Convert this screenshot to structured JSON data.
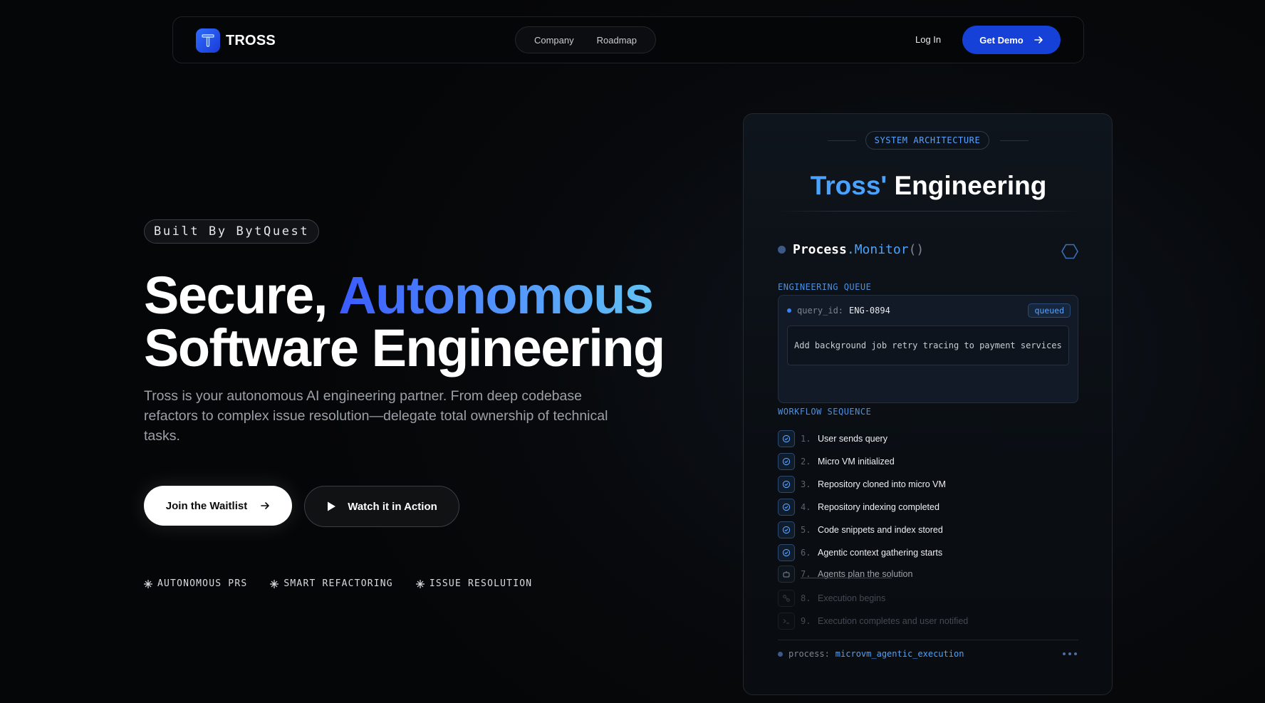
{
  "nav": {
    "brand": "TROSS",
    "links": [
      "Company",
      "Roadmap"
    ],
    "login": "Log In",
    "demo": "Get Demo"
  },
  "hero": {
    "badge": "Built By BytQuest",
    "headline_part1": "Secure, ",
    "headline_highlight": "Autonomous",
    "headline_part2": "Software Engineering",
    "subtitle": "Tross is your autonomous AI engineering partner. From deep codebase refactors to complex issue resolution—delegate total ownership of technical tasks.",
    "cta_primary": "Join the Waitlist",
    "cta_secondary": "Watch it in Action",
    "features": [
      "AUTONOMOUS PRS",
      "SMART REFACTORING",
      "ISSUE RESOLUTION"
    ]
  },
  "panel": {
    "tag": "SYSTEM ARCHITECTURE",
    "title_highlight": "Tross'",
    "title_rest": " Engineering",
    "monitor_name": "Process",
    "monitor_method": ".Monitor",
    "monitor_parens": "()",
    "queue_label": "ENGINEERING QUEUE",
    "query_key": "query_id:",
    "query_value": "ENG-0894",
    "query_status": "queued",
    "query_message": "Add background job retry tracing to payment services",
    "workflow_label": "WORKFLOW SEQUENCE",
    "steps": [
      {
        "num": "1.",
        "label": "User sends query",
        "icon": "check-circle-icon"
      },
      {
        "num": "2.",
        "label": "Micro VM initialized",
        "icon": "check-circle-icon"
      },
      {
        "num": "3.",
        "label": "Repository cloned into micro VM",
        "icon": "check-circle-icon"
      },
      {
        "num": "4.",
        "label": "Repository indexing completed",
        "icon": "check-circle-icon"
      },
      {
        "num": "5.",
        "label": "Code snippets and index stored",
        "icon": "check-circle-icon"
      },
      {
        "num": "6.",
        "label": "Agentic context gathering starts",
        "icon": "check-circle-icon"
      },
      {
        "num": "7.",
        "label": "Agents plan the solution",
        "icon": "robot-icon"
      },
      {
        "num": "8.",
        "label": "Execution begins",
        "icon": "link-icon"
      },
      {
        "num": "9.",
        "label": "Execution completes and user notified",
        "icon": "terminal-icon"
      }
    ],
    "process_key": "process:",
    "process_value": "microvm_agentic_execution"
  },
  "colors": {
    "accent": "#1641d8",
    "highlight": "#4aa3ff"
  }
}
